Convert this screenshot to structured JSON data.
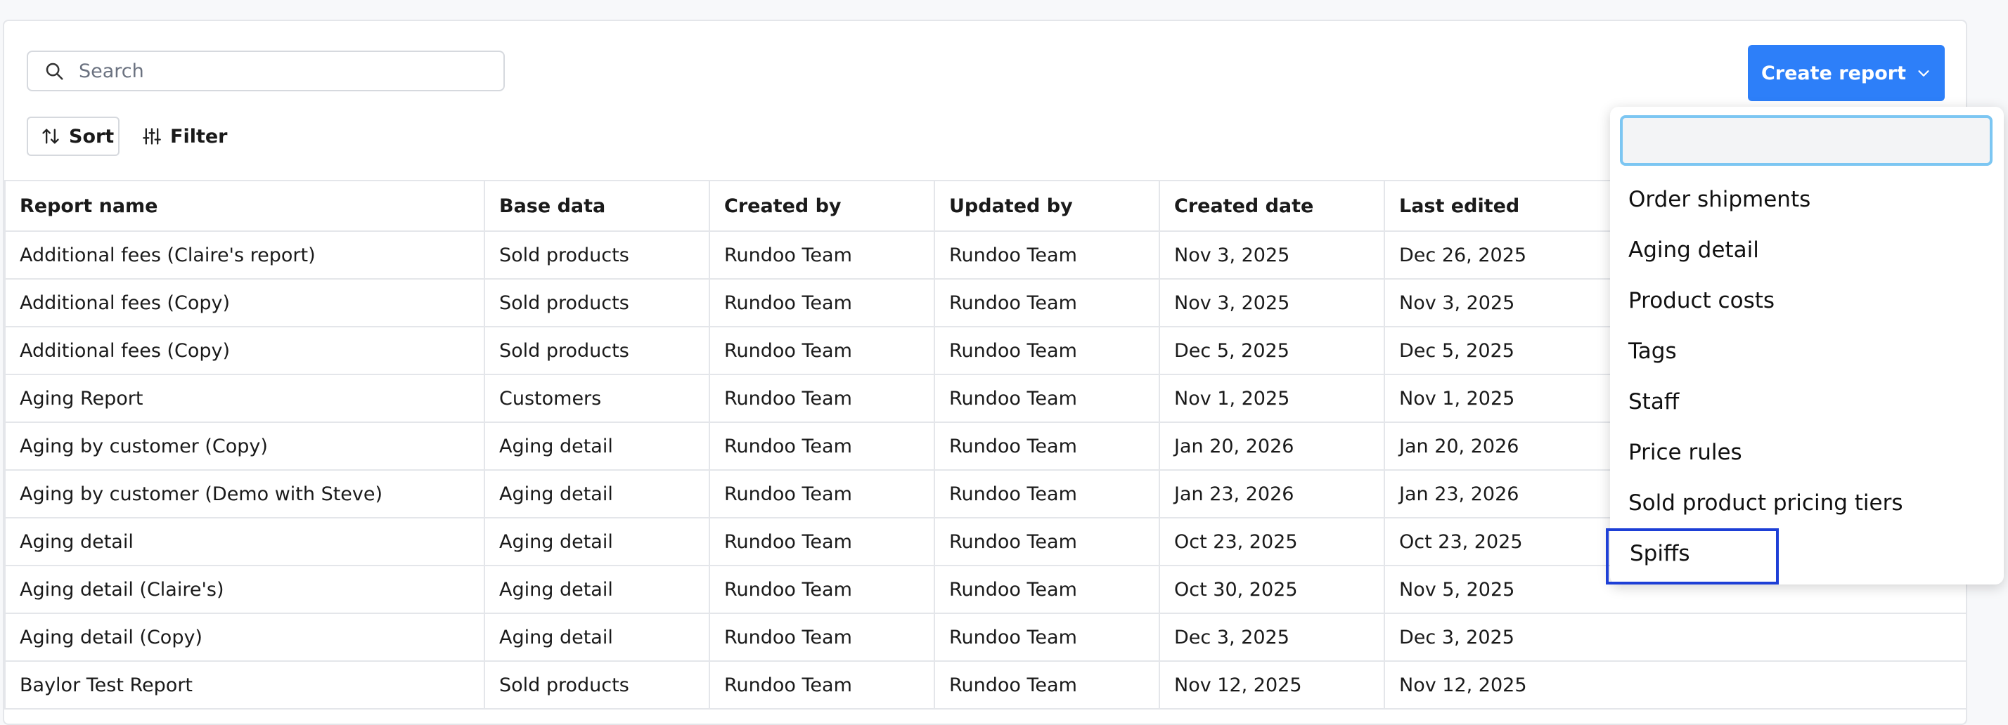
{
  "search": {
    "placeholder": "Search"
  },
  "toolbar": {
    "sort_label": "Sort",
    "filter_label": "Filter",
    "create_label": "Create report"
  },
  "table": {
    "headers": [
      "Report name",
      "Base data",
      "Created by",
      "Updated by",
      "Created date",
      "Last edited"
    ],
    "rows": [
      [
        "Additional fees (Claire's report)",
        "Sold products",
        "Rundoo Team",
        "Rundoo Team",
        "Nov 3, 2025",
        "Dec 26, 2025"
      ],
      [
        "Additional fees (Copy)",
        "Sold products",
        "Rundoo Team",
        "Rundoo Team",
        "Nov 3, 2025",
        "Nov 3, 2025"
      ],
      [
        "Additional fees (Copy)",
        "Sold products",
        "Rundoo Team",
        "Rundoo Team",
        "Dec 5, 2025",
        "Dec 5, 2025"
      ],
      [
        "Aging Report",
        "Customers",
        "Rundoo Team",
        "Rundoo Team",
        "Nov 1, 2025",
        "Nov 1, 2025"
      ],
      [
        "Aging by customer (Copy)",
        "Aging detail",
        "Rundoo Team",
        "Rundoo Team",
        "Jan 20, 2026",
        "Jan 20, 2026"
      ],
      [
        "Aging by customer (Demo with Steve)",
        "Aging detail",
        "Rundoo Team",
        "Rundoo Team",
        "Jan 23, 2026",
        "Jan 23, 2026"
      ],
      [
        "Aging detail",
        "Aging detail",
        "Rundoo Team",
        "Rundoo Team",
        "Oct 23, 2025",
        "Oct 23, 2025"
      ],
      [
        "Aging detail (Claire's)",
        "Aging detail",
        "Rundoo Team",
        "Rundoo Team",
        "Oct 30, 2025",
        "Nov 5, 2025"
      ],
      [
        "Aging detail (Copy)",
        "Aging detail",
        "Rundoo Team",
        "Rundoo Team",
        "Dec 3, 2025",
        "Dec 3, 2025"
      ],
      [
        "Baylor Test Report",
        "Sold products",
        "Rundoo Team",
        "Rundoo Team",
        "Nov 12, 2025",
        "Nov 12, 2025"
      ]
    ]
  },
  "dropdown": {
    "search_value": "",
    "items": [
      "Order shipments",
      "Aging detail",
      "Product costs",
      "Tags",
      "Staff",
      "Price rules",
      "Sold product pricing tiers",
      "Spiffs"
    ],
    "selected": "Spiffs"
  },
  "colors": {
    "accent": "#2d7ff9",
    "focus_outline": "#1d3fd6",
    "input_focus": "#7cc6f2",
    "border": "#e4e6ea"
  },
  "icons": {
    "search": "search-icon",
    "sort": "sort-arrows-icon",
    "filter": "sliders-icon",
    "dropdown": "chevron-down-icon"
  }
}
